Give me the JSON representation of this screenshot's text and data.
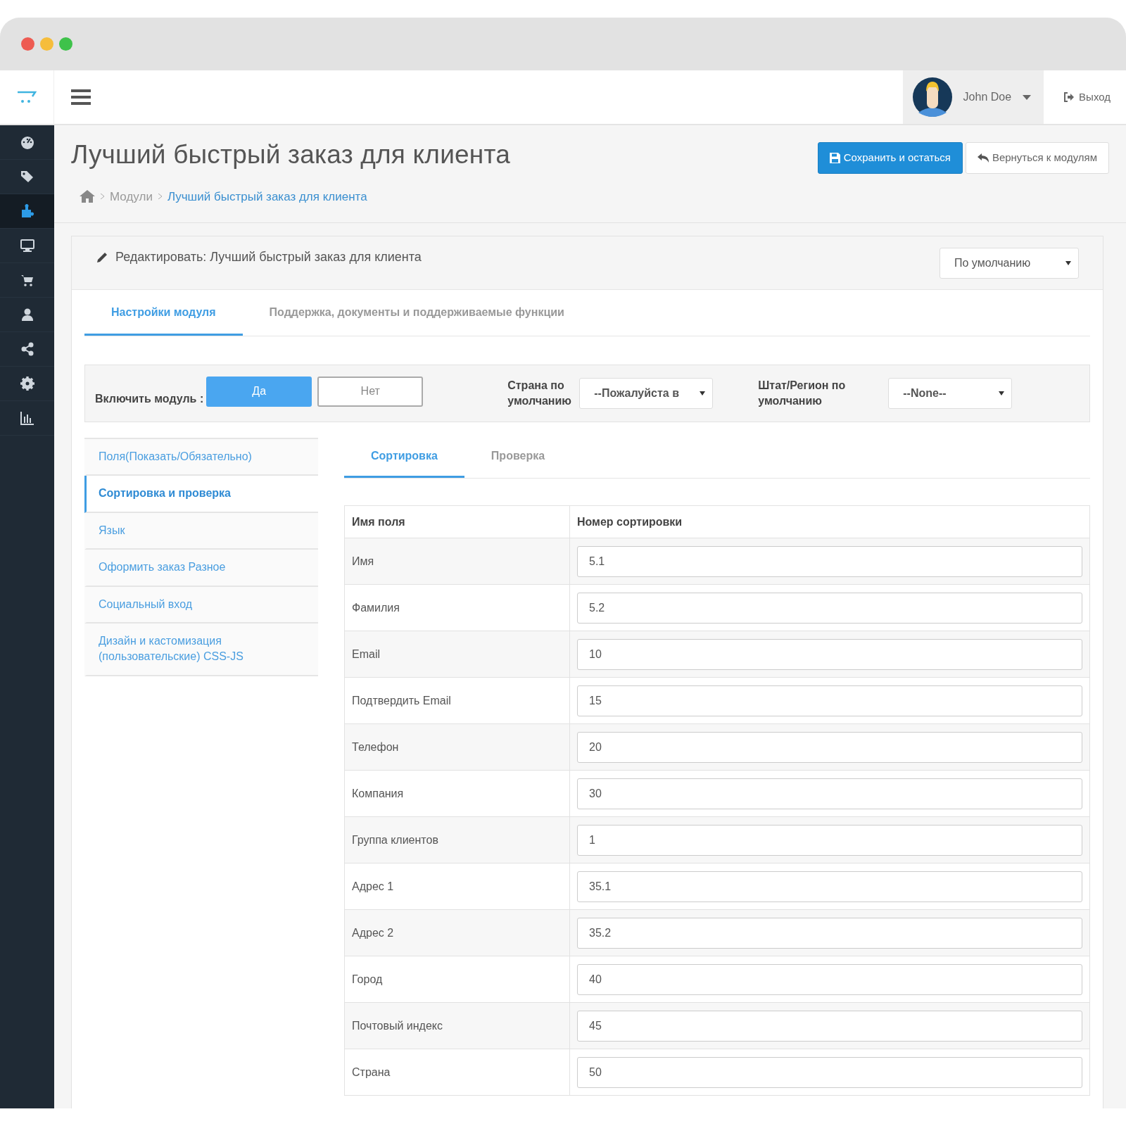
{
  "window": {
    "controls": [
      {
        "color": "#ee5b52"
      },
      {
        "color": "#f6bd3b"
      },
      {
        "color": "#3ec24a"
      }
    ]
  },
  "header": {
    "user_name": "John Doe",
    "logout": "Выход"
  },
  "sidebar": {
    "items": [
      {
        "kind": "dashboard",
        "selected": false
      },
      {
        "kind": "tags",
        "selected": false
      },
      {
        "kind": "puzzle",
        "selected": true
      },
      {
        "kind": "desktop",
        "selected": false
      },
      {
        "kind": "cart",
        "selected": false
      },
      {
        "kind": "user",
        "selected": false
      },
      {
        "kind": "share",
        "selected": false
      },
      {
        "kind": "gear",
        "selected": false
      },
      {
        "kind": "chart",
        "selected": false
      }
    ]
  },
  "page": {
    "title": "Лучший быстрый заказ для клиента",
    "breadcrumb": [
      "Модули",
      "Лучший быстрый заказ для клиента"
    ],
    "buttons": [
      {
        "kind": "primary",
        "label": "Сохранить и остаться"
      },
      {
        "kind": "back",
        "label": "Вернуться к модулям"
      }
    ]
  },
  "panel": {
    "heading": "Редактировать: Лучший быстрый заказ для клиента",
    "store_select": "По умолчанию",
    "tabs": [
      {
        "label": "Настройки модуля",
        "selected": true
      },
      {
        "label": "Поддержка, документы и поддерживаемые функции",
        "selected": false
      }
    ],
    "enable": {
      "label": "Включить модуль :",
      "options": [
        {
          "label": "Да",
          "selected": true
        },
        {
          "label": "Нет",
          "selected": false
        }
      ]
    },
    "country": {
      "label": "Страна по умолчанию",
      "value": "--Пожалуйста в"
    },
    "region": {
      "label": "Штат/Регион по умолчанию",
      "value": "--None--"
    },
    "menu": [
      {
        "label": "Поля(Показать/Обязательно)",
        "selected": false
      },
      {
        "label": "Сортировка и проверка",
        "selected": true
      },
      {
        "label": "Язык",
        "selected": false
      },
      {
        "label": "Оформить заказ Разное",
        "selected": false
      },
      {
        "label": "Социальный вход",
        "selected": false
      },
      {
        "label": "Дизайн и кастомизация (пользовательские) CSS-JS",
        "selected": false
      }
    ],
    "subtabs": [
      {
        "label": "Сортировка",
        "selected": true
      },
      {
        "label": "Проверка",
        "selected": false
      }
    ],
    "table": {
      "columns": [
        "Имя поля",
        "Номер сортировки"
      ],
      "rows": [
        {
          "name": "Имя",
          "value": "5.1"
        },
        {
          "name": "Фамилия",
          "value": "5.2"
        },
        {
          "name": "Email",
          "value": "10"
        },
        {
          "name": "Подтвердить Email",
          "value": "15"
        },
        {
          "name": "Телефон",
          "value": "20"
        },
        {
          "name": "Компания",
          "value": "30"
        },
        {
          "name": "Группа клиентов",
          "value": "1"
        },
        {
          "name": "Адрес 1",
          "value": "35.1"
        },
        {
          "name": "Адрес 2",
          "value": "35.2"
        },
        {
          "name": "Город",
          "value": "40"
        },
        {
          "name": "Почтовый индекс",
          "value": "45"
        },
        {
          "name": "Страна",
          "value": "50"
        }
      ]
    }
  }
}
